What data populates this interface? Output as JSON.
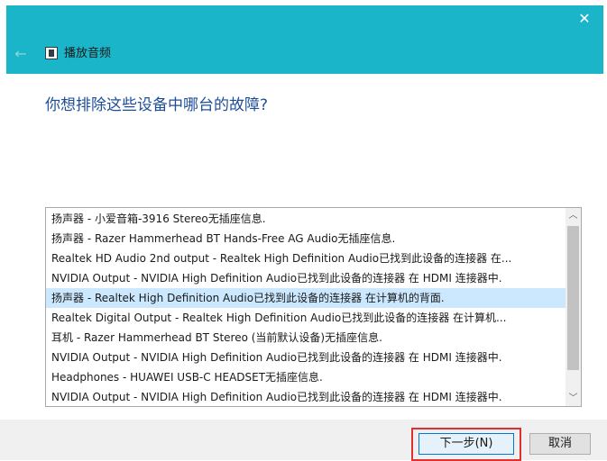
{
  "window": {
    "title": "播放音频",
    "close_glyph": "✕",
    "back_glyph": "←",
    "app_icon": "speaker-document-icon",
    "accent_color": "#1ab5c9"
  },
  "main": {
    "question": "你想排除这些设备中哪台的故障?"
  },
  "devices": {
    "items": [
      "扬声器 - 小爱音箱-3916 Stereo无插座信息.",
      "扬声器 - Razer Hammerhead BT Hands-Free AG Audio无插座信息.",
      "Realtek HD Audio 2nd output - Realtek High Definition Audio已找到此设备的连接器 在...",
      "NVIDIA Output - NVIDIA High Definition Audio已找到此设备的连接器 在 HDMI 连接器中.",
      "扬声器 - Realtek High Definition Audio已找到此设备的连接器 在计算机的背面.",
      "Realtek Digital Output - Realtek High Definition Audio已找到此设备的连接器 在计算机...",
      "耳机 - Razer Hammerhead BT Stereo (当前默认设备)无插座信息.",
      "NVIDIA Output - NVIDIA High Definition Audio已找到此设备的连接器 在 HDMI 连接器中.",
      "Headphones - HUAWEI USB-C HEADSET无插座信息.",
      "NVIDIA Output - NVIDIA High Definition Audio已找到此设备的连接器 在 HDMI 连接器中."
    ],
    "selected_index": 4,
    "scroll_up_glyph": "︿",
    "scroll_down_glyph": "﹀"
  },
  "footer": {
    "next_label": "下一步(N)",
    "cancel_label": "取消"
  }
}
